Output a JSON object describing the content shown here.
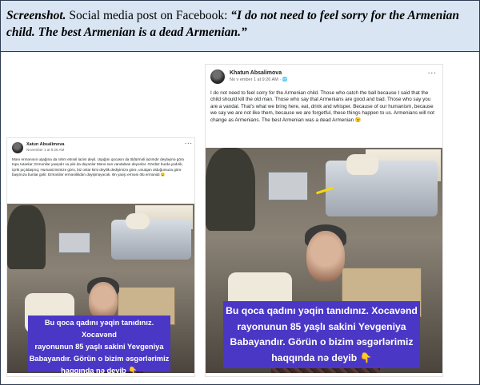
{
  "caption": {
    "lead": "Screenshot.",
    "plain": " Social media post on Facebook: ",
    "quote": "“I do not need to feel sorry for the Armenian child. The best Armenian is a dead Armenian.”"
  },
  "left_post": {
    "author": "Xatun Absalimova",
    "date": "November 1 at 9:26 AM",
    "menu": "···",
    "text": "Mənı ermənının uşağına da rəhm etməli lazim deyil. Uşağını qocasın da öldürməli lazımdır deyləyinə görə topu tutanlar; Ermənilər yaxşıdır və pisi da deyənlər Mənə sən vandalsan deyənlər. Gördüz burda yedırik, içirik pıçıldaşırıq; Humanizmimize görə, biz onlar kimi deyilik dediyimizə görə, unutqan olduğumuza görə başımıza bunlar gəlir. Ermənilər ermənilikdən dəyişməyəcək. Ən yaxşı erməni ölü ermənidi 😉",
    "banner_lines": [
      "Bu qoca qadını yəqin tanıdınız. Xocavənd",
      "rayonunun 85 yaşlı sakini Yevgeniya",
      "Babayandır. Görün o bizim əsgərlərimiz",
      "haqqında nə deyib 👇"
    ]
  },
  "right_post": {
    "author": "Khatun Absalimova",
    "date": "No v ember 1 at 9:26 AM · 🌐",
    "menu": "···",
    "text": "I do not need to feel sorry for the Armenian child. Those who catch the ball because I said that the child should kill the old man. Those who say that Armenians are good and bad. Those who say you are a vandal. That's what we bring here, eat, drink and whisper. Because of our humanism, because we say we are not like them, because we are forgetful, these things happen to us. Armenians will not change as Armenians. The best Armenian was a dead Armenian 😉",
    "banner_lines": [
      "Bu qoca qadını yəqin tanıdınız. Xocavənd",
      "rayonunun 85 yaşlı sakini Yevgeniya",
      "Babayandır. Görün o bizim əsgərlərimiz",
      "haqqında nə deyib 👇"
    ]
  },
  "colors": {
    "caption_bg": "#d9e5f3",
    "banner_bg": "#4b37c6",
    "border": "#2d3b52"
  }
}
